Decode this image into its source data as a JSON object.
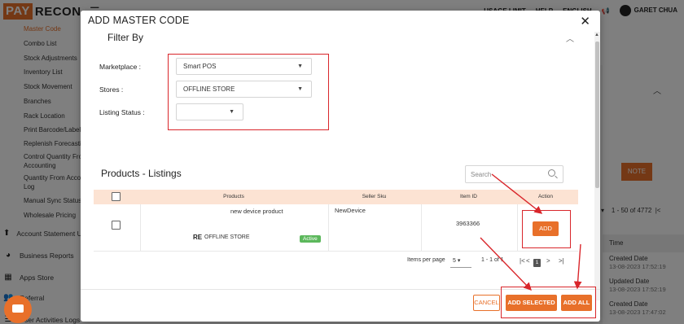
{
  "app": {
    "logo_pay": "PAY",
    "logo_recon": "RECON",
    "top_nav": [
      "USAGE LIMIT",
      "HELP",
      "ENGLISH"
    ],
    "user_name": "GARET CHUA"
  },
  "sidebar": {
    "sub_items": [
      {
        "label": "Master Code",
        "active": true
      },
      {
        "label": "Combo List"
      },
      {
        "label": "Stock Adjustments"
      },
      {
        "label": "Inventory List"
      },
      {
        "label": "Stock Movement"
      },
      {
        "label": "Branches"
      },
      {
        "label": "Rack Location"
      },
      {
        "label": "Print Barcode/Label"
      },
      {
        "label": "Replenish Forecasting"
      },
      {
        "label": "Control Quantity From"
      },
      {
        "label": "Accounting"
      },
      {
        "label": "Quantity From Accounting"
      },
      {
        "label": "Log"
      },
      {
        "label": "Manual Sync Status"
      },
      {
        "label": "Wholesale Pricing"
      }
    ],
    "main_items": [
      {
        "label": "Account Statement Upload",
        "icon": "upload-icon"
      },
      {
        "label": "Business Reports",
        "icon": "pie-chart-icon"
      },
      {
        "label": "Apps Store",
        "icon": "grid-icon"
      },
      {
        "label": "Referral",
        "icon": "users-icon"
      },
      {
        "label": "User Activities Logs",
        "icon": "list-icon"
      }
    ]
  },
  "background": {
    "note_button": "NOTE",
    "pager_text": "1 - 50 of 4772",
    "time_header": "Time",
    "logs": [
      {
        "action": "Created Date",
        "date": "13-08-2023 17:52:19"
      },
      {
        "action": "Updated Date",
        "date": "13-08-2023 17:52:19"
      },
      {
        "action": "Created Date",
        "date": "13-08-2023 17:47:02"
      }
    ]
  },
  "modal": {
    "title": "ADD MASTER CODE",
    "filter_heading": "Filter By",
    "filters": {
      "marketplace_label": "Marketplace :",
      "marketplace_value": "Smart POS",
      "stores_label": "Stores :",
      "stores_value": "OFFLINE STORE",
      "listing_status_label": "Listing Status :",
      "listing_status_value": ""
    },
    "section_title": "Products - Listings",
    "search_placeholder": "Search",
    "table": {
      "headers": [
        "Products",
        "Seller Sku",
        "Item ID",
        "Action"
      ],
      "rows": [
        {
          "product": "new device product",
          "store_badge": "RE",
          "store": "OFFLINE STORE",
          "status": "Active",
          "seller_sku": "NewDevice",
          "item_id": "3963366",
          "action": "ADD"
        }
      ]
    },
    "pagination": {
      "items_per_page_label": "Items per page",
      "items_per_page": "5",
      "range": "1 - 1 of 1",
      "current_page": "1"
    },
    "buttons": {
      "cancel": "CANCEL",
      "add_selected": "ADD SELECTED",
      "add_all": "ADD ALL"
    }
  },
  "colors": {
    "accent": "#e8702a",
    "annotation_red": "#d9262b",
    "header_row": "#fce3d3",
    "active_badge": "#5cb85c"
  }
}
